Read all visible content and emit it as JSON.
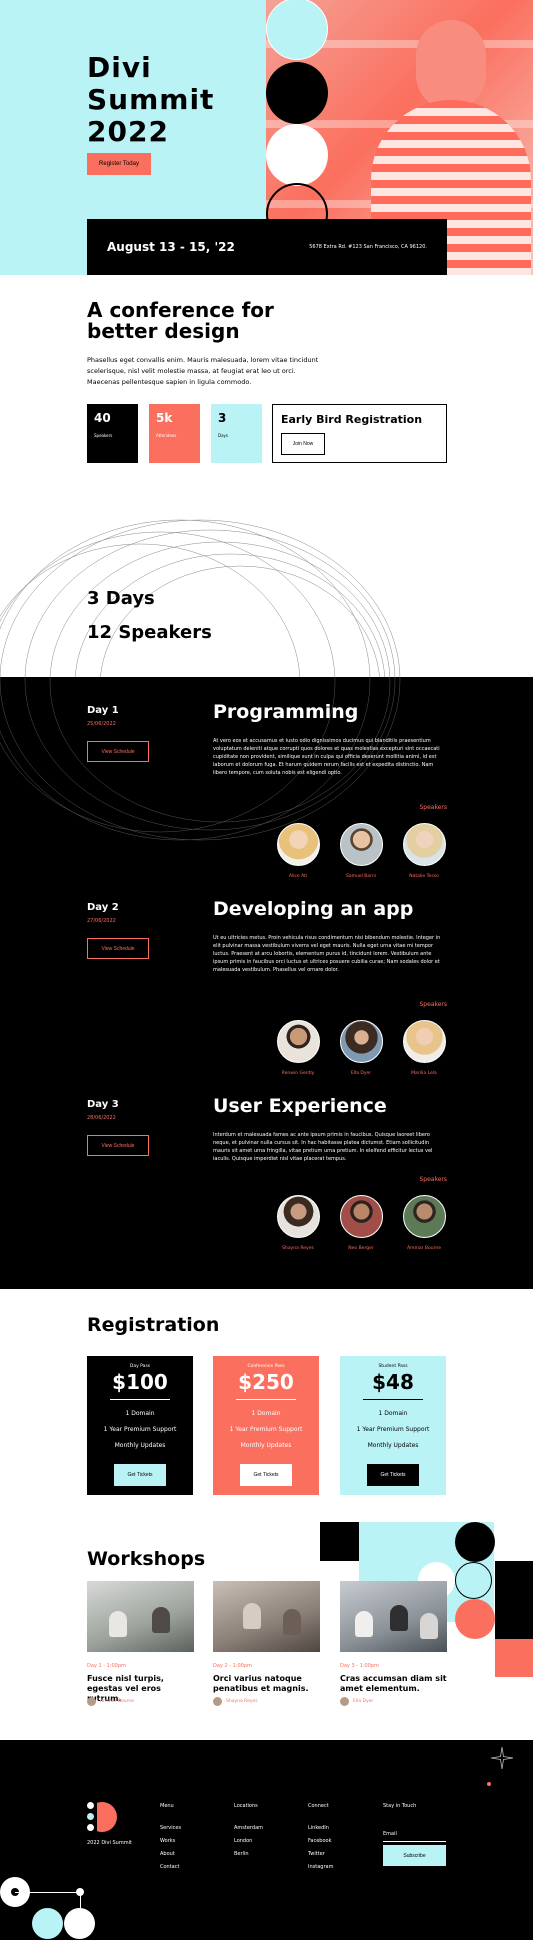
{
  "colors": {
    "coral": "#fb6f5e",
    "aqua": "#b9f3f6",
    "black": "#000000",
    "white": "#ffffff"
  },
  "hero": {
    "title_line1": "Divi",
    "title_line2": "Summit",
    "title_line3": "2022",
    "register_label": "Register Today",
    "dates": "August 13 - 15, '22",
    "address": "5678 Extra Rd. #123 San Francisco, CA 96120."
  },
  "about": {
    "heading_line1": "A conference for",
    "heading_line2": "better design",
    "body": "Phasellus eget convallis enim. Mauris malesuada, lorem vitae tincidunt scelerisque, nisl velit molestie massa, at feugiat erat leo ut orci. Maecenas pellentesque sapien in ligula commodo.",
    "stats": [
      {
        "number": "40",
        "label": "Speakers"
      },
      {
        "number": "5k",
        "label": "Attendees"
      },
      {
        "number": "3",
        "label": "Days"
      }
    ],
    "early_bird_title": "Early Bird Registration",
    "join_label": "Join Now"
  },
  "summary": {
    "line1": "3 Days",
    "line2": "12 Speakers"
  },
  "schedule": {
    "speakers_label": "Speakers",
    "view_label": "View Schedule",
    "days": [
      {
        "day": "Day 1",
        "date": "25/06/2022",
        "title": "Programming",
        "desc": "At vero eos et accusamus et iusto odio dignissimos ducimus qui blanditiis praesentium voluptatum deleniti atque corrupti quos dolores et quas molestias excepturi sint occaecati cupiditate non provident, similique sunt in culpa qui officia deserunt mollitia animi, id est laborum et dolorum fuga. Et harum quidem rerum facilis est et expedita distinctio. Nam libero tempore, cum soluta nobis est eligendi optio.",
        "speakers": [
          "Alice Ati",
          "Samuel Barni",
          "Natalie Tesso"
        ]
      },
      {
        "day": "Day 2",
        "date": "27/06/2022",
        "title": "Developing an app",
        "desc": "Ut eu ultricies metus. Proin vehicula risus condimentum nisi bibendum molestie. Integer in elit pulvinar massa vestibulum viverra vel eget mauris. Nulla eget urna vitae mi tempor luctus. Praesent at arcu lobortis, elementum purus id, tincidunt lorem. Vestibulum ante ipsum primis in faucibus orci luctus et ultrices posuere cubilia curae; Nam sodales dolor et malesuada vestibulum. Phasellus vel ornare dolor.",
        "speakers": [
          "Renwin Gently",
          "Ella Dyer",
          "Marilia Lela"
        ]
      },
      {
        "day": "Day 3",
        "date": "28/06/2022",
        "title": "User Experience",
        "desc": "Interdum et malesuada fames ac ante ipsum primis in faucibus. Quisque laoreet libero neque, et pulvinar nulla cursus sit. In hac habitasse platea dictumst. Etiam sollicitudin mauris sit amet urna fringilla, vitae pretium urna pretium. In eleifend efficitur lectus vel iaculis. Quisque imperdiet nisl vitae placerat tempus.",
        "speakers": [
          "Shayna Reyes",
          "Neo Berger",
          "Ammar Bourne"
        ]
      }
    ]
  },
  "registration": {
    "heading": "Registration",
    "button_label": "Get Tickets",
    "passes": [
      {
        "label": "Day Pass",
        "price": "$100"
      },
      {
        "label": "Conference Pass",
        "price": "$250"
      },
      {
        "label": "Student Pass",
        "price": "$48"
      }
    ],
    "features": [
      "1 Domain",
      "1 Year Premium Support",
      "Monthly Updates"
    ]
  },
  "workshops": {
    "heading": "Workshops",
    "items": [
      {
        "date": "Day 1 - 1:00pm",
        "title": "Fusce nisl turpis, egestas vel eros rutrum.",
        "author": "Ammar Bourne"
      },
      {
        "date": "Day 2 - 1:00pm",
        "title": "Orci varius natoque penatibus et magnis.",
        "author": "Shayna Reyes"
      },
      {
        "date": "Day 3 - 1:00pm",
        "title": "Cras accumsan diam sit amet elementum.",
        "author": "Ella Dyer"
      }
    ]
  },
  "footer": {
    "brand": "2022 Divi Summit",
    "menu": {
      "heading": "Menu",
      "items": [
        "Services",
        "Works",
        "About",
        "Contact"
      ]
    },
    "locations": {
      "heading": "Locations",
      "items": [
        "Amsterdam",
        "London",
        "Berlin"
      ]
    },
    "connect": {
      "heading": "Connect",
      "items": [
        "LinkedIn",
        "Facebook",
        "Twitter",
        "Instagram"
      ]
    },
    "newsletter": {
      "heading": "Stay in Touch",
      "email_label": "Email",
      "subscribe_label": "Subscribe"
    }
  }
}
